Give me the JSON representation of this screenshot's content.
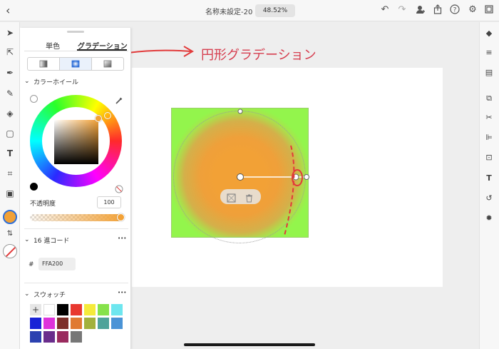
{
  "header": {
    "title": "名称未設定-20",
    "zoom": "48.52%"
  },
  "panel": {
    "tabs": [
      "単色",
      "グラデーション"
    ],
    "gradient_types": [
      "linear",
      "radial",
      "freeform"
    ],
    "color_wheel_label": "カラーホイール",
    "opacity_label": "不透明度",
    "opacity_value": "100",
    "hex_section_label": "16 進コード",
    "hash": "#",
    "hex_value": "FFA200",
    "swatches_label": "スウォッチ",
    "add_glyph": "+",
    "more_glyph": "•••"
  },
  "annotation": {
    "text": "円形グラデーション",
    "color": "#d63e4f"
  },
  "colors": {
    "fill": "#f2a136",
    "outer": "#93f54c",
    "accent_red": "#e23a3a"
  },
  "swatch_colors": [
    "#ffffff",
    "#000000",
    "#e8382f",
    "#f5ea3b",
    "#86e24b",
    "#6ee6ef",
    "#1922d6",
    "#de33db",
    "#7d2f2a",
    "#e07a33",
    "#a2b13c",
    "#4fa39a",
    "#4a93d6",
    "#2c41b0",
    "#6a2d8c",
    "#9a2b5e",
    "#777777"
  ]
}
